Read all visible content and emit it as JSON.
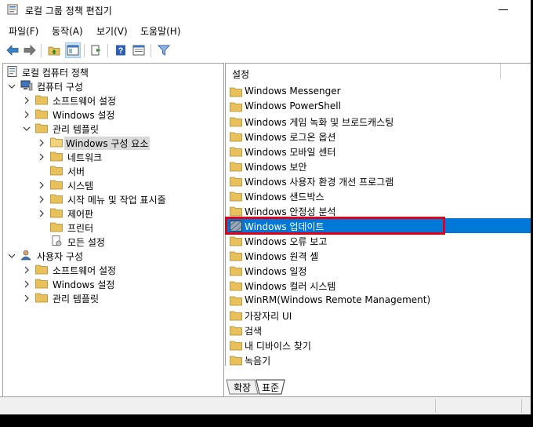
{
  "window": {
    "title": "로컬 그룹 정책 편집기"
  },
  "menu": [
    "파일(F)",
    "동작(A)",
    "보기(V)",
    "도움말(H)"
  ],
  "toolbar": {
    "icons": [
      "back-arrow-icon",
      "forward-arrow-icon",
      "up-folder-icon",
      "show-hide-tree-icon",
      "export-list-icon",
      "help-icon",
      "properties-icon",
      "filter-icon"
    ]
  },
  "tree": [
    {
      "label": "로컬 컴퓨터 정책",
      "icon": "policy-icon"
    },
    {
      "label": "컴퓨터 구성",
      "icon": "computer-icon"
    },
    {
      "label": "소프트웨어 설정",
      "icon": "folder-icon"
    },
    {
      "label": "Windows 설정",
      "icon": "folder-icon"
    },
    {
      "label": "관리 템플릿",
      "icon": "folder-icon"
    },
    {
      "label": "Windows 구성 요소",
      "icon": "folder-icon",
      "selected": true
    },
    {
      "label": "네트워크",
      "icon": "folder-icon"
    },
    {
      "label": "서버",
      "icon": "folder-icon"
    },
    {
      "label": "시스템",
      "icon": "folder-icon"
    },
    {
      "label": "시작 메뉴 및 작업 표시줄",
      "icon": "folder-icon"
    },
    {
      "label": "제어판",
      "icon": "folder-icon"
    },
    {
      "label": "프린터",
      "icon": "folder-icon"
    },
    {
      "label": "모든 설정",
      "icon": "all-settings-icon"
    },
    {
      "label": "사용자 구성",
      "icon": "user-icon"
    },
    {
      "label": "소프트웨어 설정",
      "icon": "folder-icon"
    },
    {
      "label": "Windows 설정",
      "icon": "folder-icon"
    },
    {
      "label": "관리 템플릿",
      "icon": "folder-icon"
    }
  ],
  "list": {
    "header": "설정",
    "items": [
      "Windows Messenger",
      "Windows PowerShell",
      "Windows 게임 녹화 및 브로드캐스팅",
      "Windows 로그온 옵션",
      "Windows 모바일 센터",
      "Windows 보안",
      "Windows 사용자 환경 개선 프로그램",
      "Windows 샌드박스",
      "Windows 안정성 분석",
      "Windows 업데이트",
      "Windows 오류 보고",
      "Windows 원격 셸",
      "Windows 일정",
      "Windows 컬러 시스템",
      "WinRM(Windows Remote Management)",
      "가장자리 UI",
      "검색",
      "내 디바이스 찾기",
      "녹음기"
    ],
    "selected_index": 9
  },
  "tabs": [
    "확장",
    "표준"
  ],
  "colors": {
    "selection": "#0078d7",
    "highlight_box": "#e0001a",
    "folder": "#e8c15a"
  }
}
